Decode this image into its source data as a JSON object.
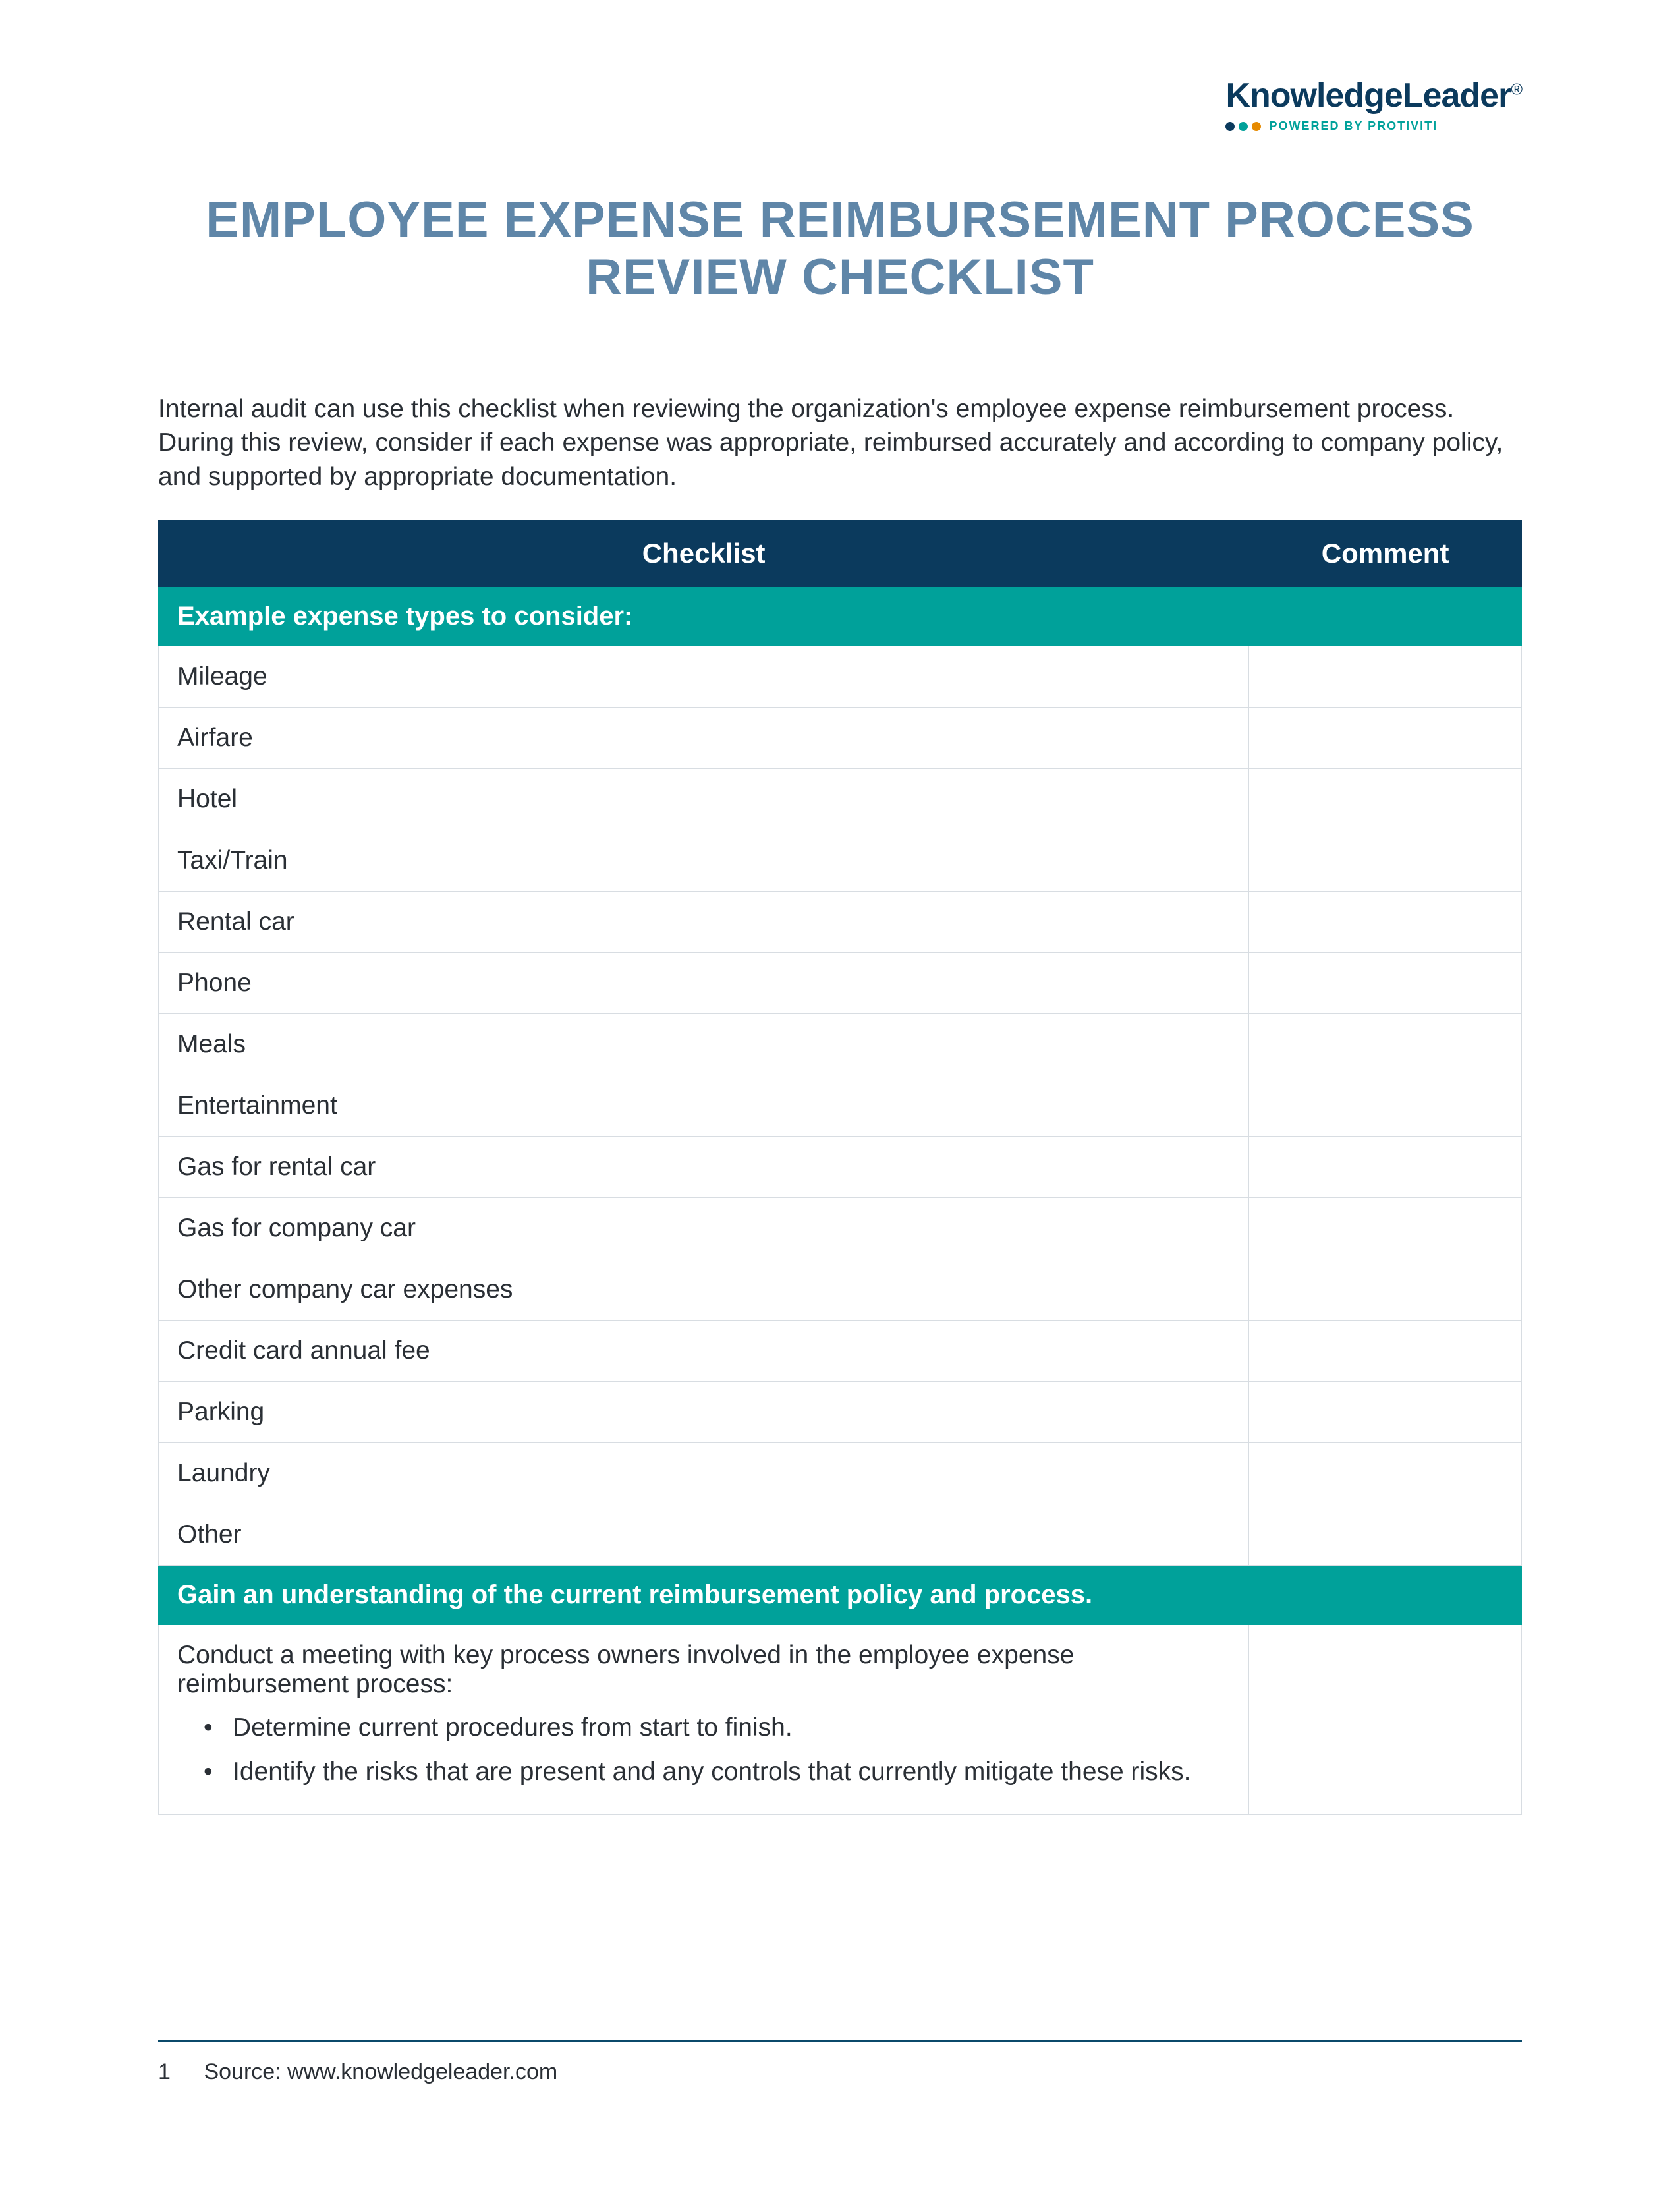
{
  "brand": {
    "name": "KnowledgeLeader",
    "reg": "®",
    "tagline": "POWERED BY PROTIVITI"
  },
  "title": "EMPLOYEE EXPENSE REIMBURSEMENT PROCESS REVIEW CHECKLIST",
  "intro": "Internal audit can use this checklist when reviewing the organization's employee expense reimbursement process. During this review, consider if each expense was appropriate, reimbursed accurately and according to company policy, and supported by appropriate documentation.",
  "table": {
    "headers": {
      "checklist": "Checklist",
      "comment": "Comment"
    },
    "sections": [
      {
        "heading": "Example expense types to consider:",
        "items": [
          "Mileage",
          "Airfare",
          "Hotel",
          "Taxi/Train",
          "Rental car",
          "Phone",
          "Meals",
          "Entertainment",
          "Gas for rental car",
          "Gas for company car",
          "Other company car expenses",
          "Credit card annual fee",
          "Parking",
          "Laundry",
          "Other"
        ]
      },
      {
        "heading": "Gain an understanding of the current reimbursement policy and process.",
        "complex": {
          "lead": "Conduct a meeting with key process owners involved in the employee expense reimbursement process:",
          "bullets": [
            "Determine current procedures from start to finish.",
            "Identify the risks that are present and any controls that currently mitigate these risks."
          ]
        }
      }
    ]
  },
  "footer": {
    "page": "1",
    "source": "Source: www.knowledgeleader.com"
  }
}
